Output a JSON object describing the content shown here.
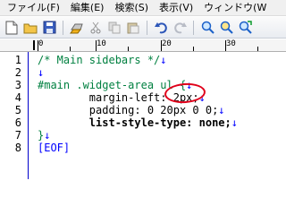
{
  "menubar": {
    "items": [
      {
        "label": "ファイル(F)"
      },
      {
        "label": "編集(E)"
      },
      {
        "label": "検索(S)"
      },
      {
        "label": "表示(V)"
      },
      {
        "label": "ウィンドウ(W"
      }
    ]
  },
  "toolbar": {
    "buttons": [
      {
        "icon": "new-file-icon"
      },
      {
        "icon": "open-folder-icon"
      },
      {
        "icon": "save-icon"
      },
      {
        "icon": "print-icon"
      },
      {
        "icon": "cut-icon"
      },
      {
        "icon": "copy-icon"
      },
      {
        "icon": "paste-icon"
      },
      {
        "icon": "undo-icon"
      },
      {
        "icon": "redo-icon"
      },
      {
        "icon": "find-icon"
      },
      {
        "icon": "find-next-icon"
      },
      {
        "icon": "replace-icon"
      }
    ]
  },
  "ruler": {
    "labels": [
      "0",
      "10",
      "20",
      "30"
    ]
  },
  "editor": {
    "lines": [
      {
        "num": "1",
        "text": "/* Main sidebars */",
        "eol": "↓",
        "kind": "comment"
      },
      {
        "num": "2",
        "text": "",
        "eol": "↓",
        "kind": "plain"
      },
      {
        "num": "3",
        "text": "#main .widget-area ul {",
        "eol": "↓",
        "kind": "selector"
      },
      {
        "num": "4",
        "text": "        margin-left: 2px;",
        "eol": "↓",
        "kind": "prop"
      },
      {
        "num": "5",
        "text": "        padding: 0 20px 0 0;",
        "eol": "↓",
        "kind": "prop"
      },
      {
        "num": "6",
        "text": "        list-style-type: none;",
        "eol": "↓",
        "kind": "strong"
      },
      {
        "num": "7",
        "text": "}",
        "eol": "↓",
        "kind": "selector"
      },
      {
        "num": "8",
        "text": "[EOF]",
        "eol": "",
        "kind": "eof"
      }
    ]
  },
  "colors": {
    "comment": "#008040",
    "eol_marker": "#0000ff",
    "highlight": "#e0001a"
  }
}
